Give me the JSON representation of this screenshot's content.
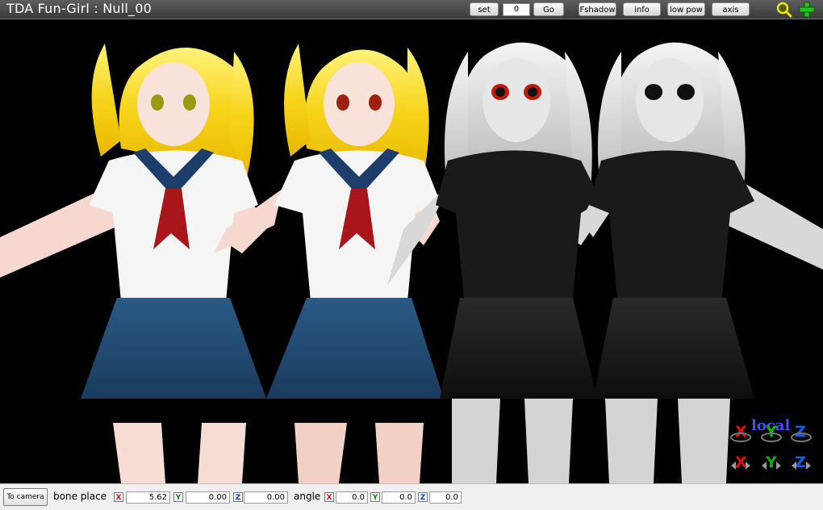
{
  "window": {
    "title": "TDA Fun-Girl : Null_00"
  },
  "toolbar": {
    "set_label": "set",
    "frame_value": "0",
    "go_label": "Go",
    "fshadow_label": "Fshadow",
    "info_label": "info",
    "lowpow_label": "low pow",
    "axis_label": "axis",
    "zoom_icon": "magnifier-icon",
    "move_icon": "move-cross-icon"
  },
  "gizmo": {
    "mode_label": "local",
    "rotate": [
      "X",
      "Y",
      "Z"
    ],
    "translate": [
      "X",
      "Y",
      "Z"
    ],
    "colors": {
      "x": "#e01010",
      "y": "#10b010",
      "z": "#1060e0"
    }
  },
  "bottom": {
    "to_camera_label": "To camera",
    "bone_place_label": "bone place",
    "angle_label": "angle",
    "place": {
      "x_tag": "X",
      "x": "5.62",
      "y_tag": "Y",
      "y": "0.00",
      "z_tag": "Z",
      "z": "0.00"
    },
    "angle": {
      "x_tag": "X",
      "x": "0.0",
      "y_tag": "Y",
      "y": "0.0",
      "z_tag": "Z",
      "z": "0.0"
    }
  }
}
